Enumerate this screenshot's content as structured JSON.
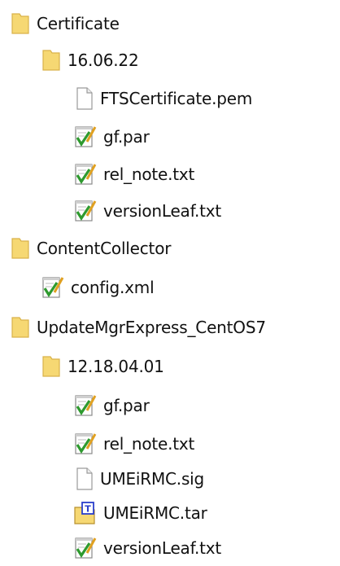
{
  "tree": [
    {
      "label": "Certificate",
      "icon": "folder-icon"
    },
    {
      "label": "16.06.22",
      "icon": "folder-icon"
    },
    {
      "label": "FTSCertificate.pem",
      "icon": "file-icon"
    },
    {
      "label": "gf.par",
      "icon": "text-file-icon"
    },
    {
      "label": "rel_note.txt",
      "icon": "text-file-icon"
    },
    {
      "label": "versionLeaf.txt",
      "icon": "text-file-icon"
    },
    {
      "label": "ContentCollector",
      "icon": "folder-icon"
    },
    {
      "label": "config.xml",
      "icon": "text-file-icon"
    },
    {
      "label": "UpdateMgrExpress_CentOS7",
      "icon": "folder-icon"
    },
    {
      "label": "12.18.04.01",
      "icon": "folder-icon"
    },
    {
      "label": "gf.par",
      "icon": "text-file-icon"
    },
    {
      "label": "rel_note.txt",
      "icon": "text-file-icon"
    },
    {
      "label": "UMEiRMC.sig",
      "icon": "file-icon"
    },
    {
      "label": "UMEiRMC.tar",
      "icon": "archive-icon"
    },
    {
      "label": "versionLeaf.txt",
      "icon": "text-file-icon"
    }
  ],
  "colors": {
    "folder": "#F6D873",
    "folder_edge": "#D9B24A",
    "pencil": "#E0A020",
    "check": "#2E9A2E",
    "archive_badge": "#2B3FCB"
  }
}
